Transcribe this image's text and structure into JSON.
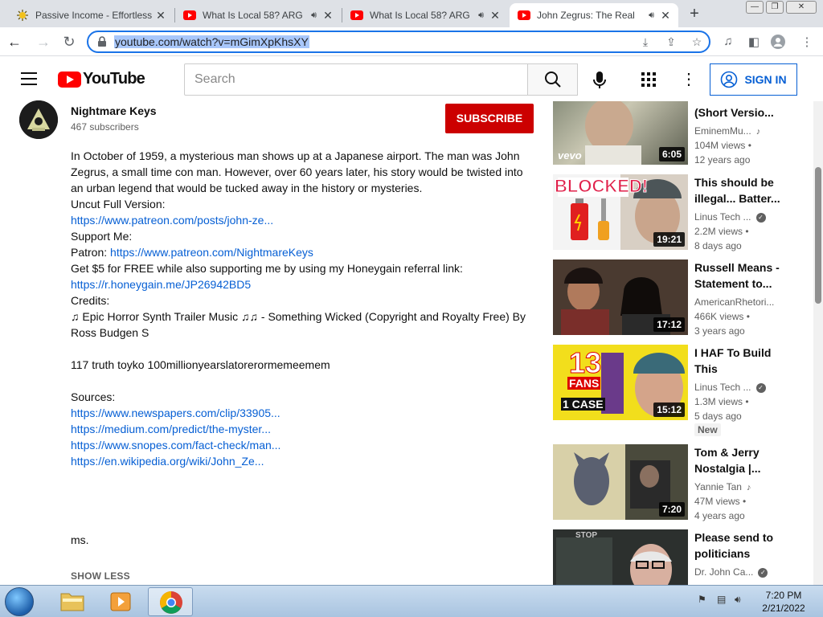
{
  "browser": {
    "tabs": [
      {
        "title": "Passive Income - Effortless",
        "audio": false
      },
      {
        "title": "What Is Local 58? ARG",
        "audio": true
      },
      {
        "title": "What Is Local 58? ARG",
        "audio": true
      },
      {
        "title": "John Zegrus: The Real",
        "audio": true,
        "active": true
      }
    ],
    "url": "youtube.com/watch?v=mGimXpKhsXY"
  },
  "youtube": {
    "logo_text": "YouTube",
    "search_placeholder": "Search",
    "sign_in": "SIGN IN"
  },
  "channel": {
    "name": "Nightmare Keys",
    "subscribers": "467 subscribers",
    "subscribe_label": "SUBSCRIBE"
  },
  "description": {
    "p1": "In October of 1959, a mysterious man shows up at a Japanese airport. The man was John Zegrus, a small time con man. However, over 60 years later, his story would be twisted into an urban legend that would be tucked away in the history or mysteries.",
    "uncut_label": "Uncut Full Version:",
    "uncut_link": "https://www.patreon.com/posts/john-ze...",
    "support_label": "Support Me:",
    "patron_label": "Patron: ",
    "patron_link": "https://www.patreon.com/NightmareKeys",
    "honeygain_text": "Get $5 for FREE while also supporting me by using my Honeygain referral link:",
    "honeygain_link": "https://r.honeygain.me/JP26942BD5",
    "credits_label": "Credits:",
    "credits_text": "♫ Epic Horror Synth Trailer Music ♫♫ - Something Wicked (Copyright and Royalty Free) By Ross Budgen S",
    "misc_line": "117 truth toyko 100millionyearslatorerormemeemem",
    "sources_label": "Sources:",
    "sources": [
      "https://www.newspapers.com/clip/33905...",
      "https://medium.com/predict/the-myster...",
      "https://www.snopes.com/fact-check/man...",
      "https://en.wikipedia.org/wiki/John_Ze..."
    ],
    "ms_line": "ms.",
    "show_less": "SHOW LESS"
  },
  "recommendations": [
    {
      "title": "(Short Versio...",
      "channel": "EminemMu...",
      "music": true,
      "views": "104M views •",
      "age": "12 years ago",
      "duration": "6:05",
      "thumb_text": "vevo"
    },
    {
      "title": "This should be illegal... Batter...",
      "channel": "Linus Tech ...",
      "verified": true,
      "views": "2.2M views •",
      "age": "8 days ago",
      "duration": "19:21",
      "thumb_text": "BLOCKED!"
    },
    {
      "title": "Russell Means - Statement to...",
      "channel": "AmericanRhetori...",
      "views": "466K views •",
      "age": "3 years ago",
      "duration": "17:12"
    },
    {
      "title": "I HAF To Build This",
      "channel": "Linus Tech ...",
      "verified": true,
      "views": "1.3M views •",
      "age": "5 days ago",
      "duration": "15:12",
      "badge": "New",
      "thumb_text_1": "13",
      "thumb_text_2": "FANS",
      "thumb_text_3": "1 CASE"
    },
    {
      "title": "Tom & Jerry Nostalgia |...",
      "channel": "Yannie Tan",
      "music": true,
      "views": "47M views •",
      "age": "4 years ago",
      "duration": "7:20"
    },
    {
      "title": "Please send to politicians",
      "channel": "Dr. John Ca...",
      "verified": true,
      "views": "",
      "age": "",
      "duration": "",
      "thumb_text": "STOP"
    }
  ],
  "taskbar": {
    "time": "7:20 PM",
    "date": "2/21/2022"
  },
  "colors": {
    "subscribe": "#cc0000",
    "link": "#065fd4",
    "yt_red": "#ff0000"
  }
}
